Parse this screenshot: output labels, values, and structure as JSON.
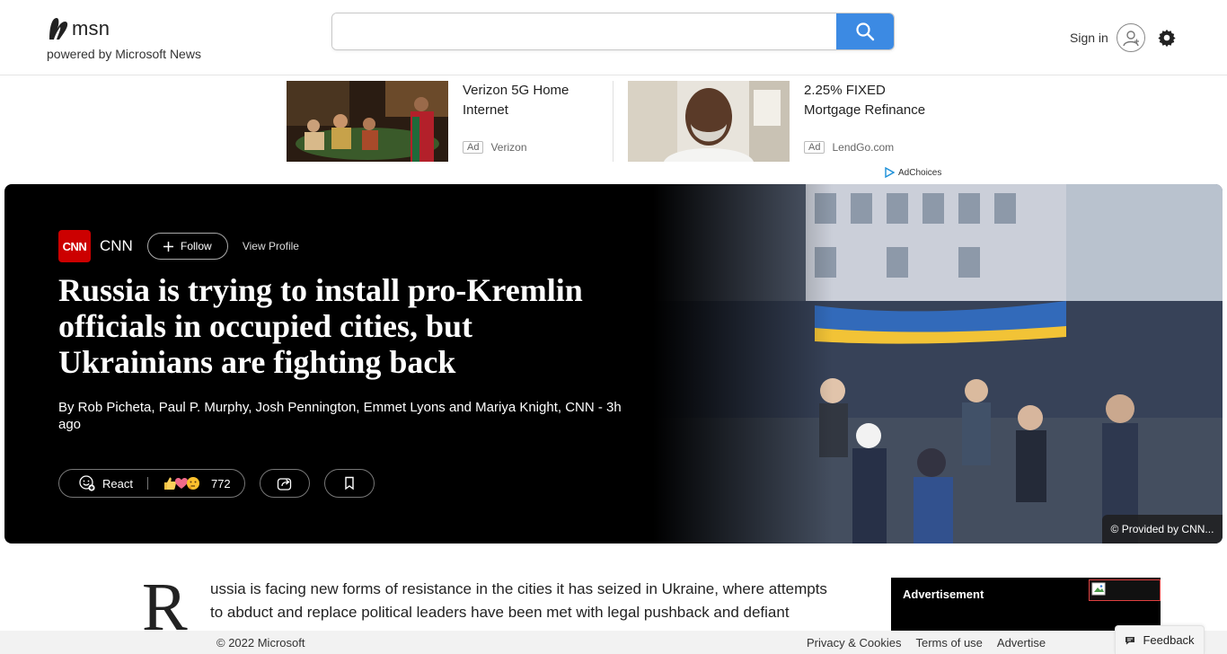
{
  "header": {
    "logo_text": "msn",
    "powered_by": "powered by Microsoft News",
    "search": {
      "value": "",
      "placeholder": ""
    },
    "sign_in_label": "Sign in"
  },
  "ads": [
    {
      "title": "Verizon 5G Home Internet",
      "badge": "Ad",
      "advertiser": "Verizon"
    },
    {
      "title": "2.25% FIXED Mortgage Refinance",
      "badge": "Ad",
      "advertiser": "LendGo.com"
    }
  ],
  "adchoices_label": "AdChoices",
  "article": {
    "source": "CNN",
    "source_logo_text": "CNN",
    "follow_label": "Follow",
    "view_profile_label": "View Profile",
    "headline": "Russia is trying to install pro-Kremlin officials in occupied cities, but Ukrainians are fighting back",
    "byline": "By Rob Picheta, Paul P. Murphy, Josh Pennington, Emmet Lyons and Mariya Knight, CNN - 3h ago",
    "react_label": "React",
    "reaction_count": "772",
    "image_credit": "© Provided by CNN...",
    "dropcap": "R",
    "body": "ussia is facing new forms of resistance in the cities it has seized in Ukraine, where attempts to abduct and replace political leaders have been met with legal pushback and defiant"
  },
  "advertisement_label": "Advertisement",
  "footer": {
    "copyright": "© 2022 Microsoft",
    "links": [
      "Privacy & Cookies",
      "Terms of use",
      "Advertise"
    ],
    "feedback_label": "Feedback"
  },
  "colors": {
    "search_button": "#3c8ae3",
    "cnn_red": "#cc0000",
    "hero_bg": "#000000"
  }
}
